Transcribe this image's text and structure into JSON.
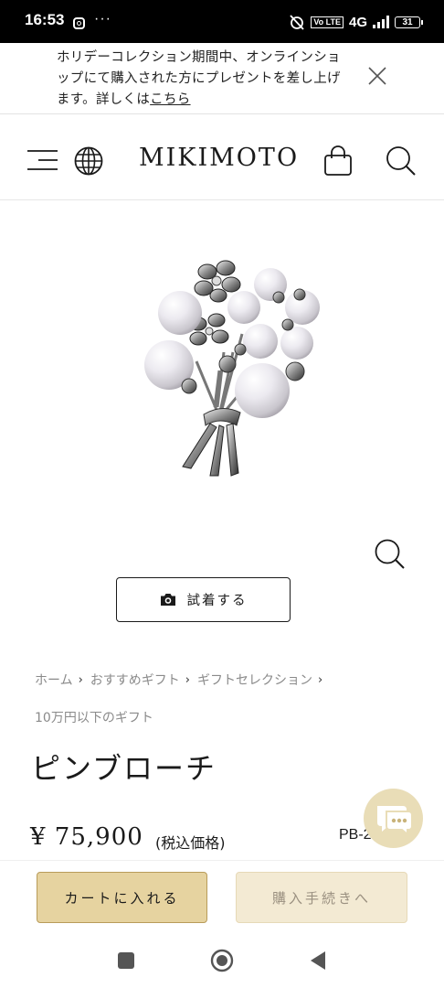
{
  "status_bar": {
    "time": "16:53",
    "overflow": "···",
    "network": "4G",
    "volte": "Vo LTE",
    "battery": "31"
  },
  "banner": {
    "text": "ホリデーコレクション期間中、オンラインショップにて購入された方にプレゼントを差し上げます。詳しくは",
    "link": "こちら"
  },
  "header": {
    "logo": "MIKIMOTO",
    "icons": [
      "menu-icon",
      "globe-icon",
      "shopping-bag-icon",
      "search-icon"
    ]
  },
  "product": {
    "image": "pearl-bouquet-brooch",
    "try_on_label": "試着する",
    "breadcrumb": [
      "ホーム",
      "おすすめギフト",
      "ギフトセレクション",
      "10万円以下のギフト"
    ],
    "name": "ピンブローチ",
    "price": "¥ 75,900",
    "tax_note": "(税込価格)",
    "code": "PB-2    "
  },
  "actions": {
    "add_to_cart": "カートに入れる",
    "checkout": "購入手続きへ"
  },
  "colors": {
    "gold_button": "#e6d3a0",
    "gold_border": "#b99c5a",
    "disabled_button": "#f3ead3",
    "chat_bubble": "#e9ddb7"
  }
}
